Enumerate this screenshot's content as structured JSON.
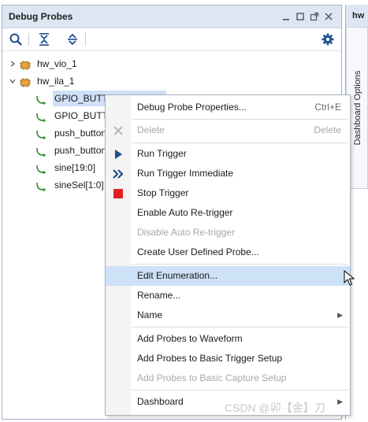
{
  "panel": {
    "title": "Debug Probes",
    "controls": [
      "minimize-icon",
      "restore-icon",
      "float-icon",
      "close-icon"
    ]
  },
  "toolbar": {
    "buttons": [
      "search-icon",
      "collapse-all-icon",
      "expand-all-icon",
      "gear-icon"
    ]
  },
  "tree": {
    "nodes": [
      {
        "label": "hw_vio_1",
        "expanded": false,
        "icon": "debug-core-icon"
      },
      {
        "label": "hw_ila_1",
        "expanded": true,
        "icon": "debug-core-icon"
      },
      {
        "label": "GPIO_BUTT",
        "icon": "probe-icon",
        "selected": true
      },
      {
        "label": "GPIO_BUTT",
        "icon": "probe-icon"
      },
      {
        "label": "push_button",
        "icon": "probe-icon"
      },
      {
        "label": "push_button",
        "icon": "probe-icon"
      },
      {
        "label": "sine[19:0]",
        "icon": "probe-icon"
      },
      {
        "label": "sineSel[1:0]",
        "icon": "probe-icon"
      }
    ]
  },
  "side_panel": {
    "tab_head": "hw",
    "vertical_tab": "Dashboard Options"
  },
  "context_menu": {
    "items": [
      {
        "label": "Debug Probe Properties...",
        "shortcut": "Ctrl+E"
      },
      {
        "label": "Delete",
        "shortcut": "Delete",
        "disabled": true,
        "icon": "delete-x-icon"
      },
      {
        "label": "Run Trigger",
        "icon": "run-trigger-icon"
      },
      {
        "label": "Run Trigger Immediate",
        "icon": "run-trigger-immediate-icon"
      },
      {
        "label": "Stop Trigger",
        "icon": "stop-trigger-icon"
      },
      {
        "label": "Enable Auto Re-trigger"
      },
      {
        "label": "Disable Auto Re-trigger",
        "disabled": true
      },
      {
        "label": "Create User Defined Probe..."
      },
      {
        "label": "Edit Enumeration...",
        "hover": true
      },
      {
        "label": "Rename..."
      },
      {
        "label": "Name",
        "submenu": true
      },
      {
        "label": "Add Probes to Waveform"
      },
      {
        "label": "Add Probes to Basic Trigger Setup"
      },
      {
        "label": "Add Probes to Basic Capture Setup",
        "disabled": true
      },
      {
        "label": "Dashboard",
        "submenu": true
      }
    ]
  },
  "watermark": "CSDN @卯【金】刀",
  "colors": {
    "header_bg": "#dde6f2",
    "selection": "#cfe0f7",
    "menu_hover": "#cde1f7",
    "run_blue": "#1f4e8c",
    "stop_red": "#e02020",
    "probe_green": "#2e8b2e"
  }
}
